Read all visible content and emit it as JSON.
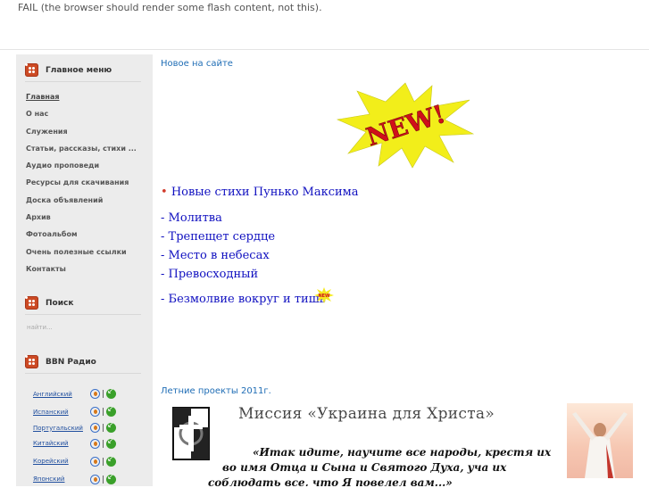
{
  "flash_fail_text": "FAIL (the browser should render some flash content, not this).",
  "sidebar": {
    "main_menu_title": "Главное меню",
    "menu": [
      "Главная",
      "О нас",
      "Служения",
      "Статьи, рассказы, стихи ...",
      "Аудио проповеди",
      "Ресурсы для скачивания",
      "Доска объявлений",
      "Архив",
      "Фотоальбом",
      "Очень полезные ссылки",
      "Контакты"
    ],
    "search_title": "Поиск",
    "search_placeholder": "найти...",
    "radio_title": "BBN Радио",
    "radio_langs": [
      "Английский",
      "Испанский",
      "Португальский",
      "Китайский",
      "Корейский",
      "Японский"
    ]
  },
  "main": {
    "news_link": "Новое на сайте",
    "new_badge_text": "NEW!",
    "new_small_badge": "NEW",
    "poems_heading_bullet": "•",
    "poems_heading": "Новые стихи Пунько Максима",
    "poems": [
      "-  Молитва",
      "- Трепещет сердце",
      "- Место в небесах",
      "- Превосходный",
      "- Безмолвие вокруг и тишь"
    ],
    "summer_link": "Летние проекты 2011г.",
    "banner_title": "Миссия «Украина для Христа»",
    "banner_quote": [
      "«Итак идите, научите все народы, крестя их",
      "во имя Отца и Сына и Святого Духа, уча их",
      "соблюдать все, что Я повелел вам...»"
    ]
  },
  "colors": {
    "accent": "#1f6db5",
    "poem_link": "#1010c0",
    "module_icon": "#cc4a24",
    "burst": "#f2ee1a",
    "new_text": "#d0101a"
  }
}
